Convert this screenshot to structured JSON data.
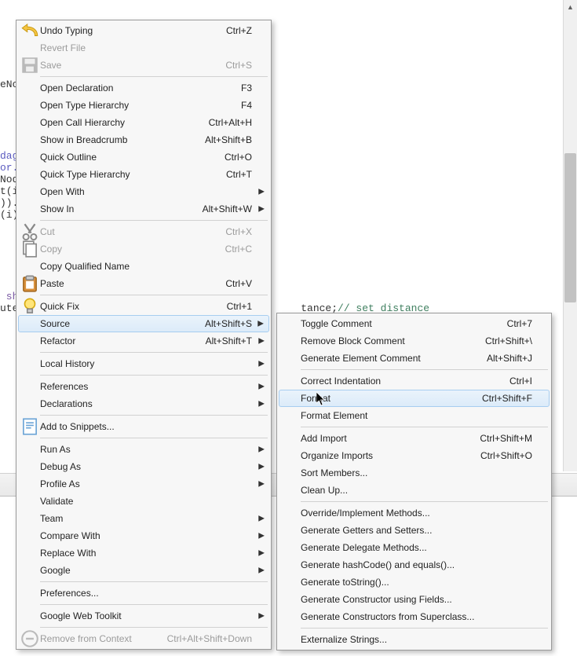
{
  "editor": {
    "visible_fragments": [
      "eNoc",
      "dage",
      "or.",
      "Nod",
      "t(i",
      ")).",
      "(i)",
      " sh",
      "ute"
    ],
    "right_code": {
      "prefix": "tance;",
      "comment": "// set distance"
    }
  },
  "main_menu": [
    {
      "icon": "undo",
      "label": "Undo Typing",
      "shortcut": "Ctrl+Z"
    },
    {
      "disabled": true,
      "label": "Revert File",
      "shortcut": ""
    },
    {
      "icon": "save",
      "disabled": true,
      "label": "Save",
      "shortcut": "Ctrl+S"
    },
    {
      "sep": true
    },
    {
      "label": "Open Declaration",
      "shortcut": "F3"
    },
    {
      "label": "Open Type Hierarchy",
      "shortcut": "F4"
    },
    {
      "label": "Open Call Hierarchy",
      "shortcut": "Ctrl+Alt+H"
    },
    {
      "label": "Show in Breadcrumb",
      "shortcut": "Alt+Shift+B"
    },
    {
      "label": "Quick Outline",
      "shortcut": "Ctrl+O"
    },
    {
      "label": "Quick Type Hierarchy",
      "shortcut": "Ctrl+T"
    },
    {
      "label": "Open With",
      "submenu": true
    },
    {
      "label": "Show In",
      "shortcut": "Alt+Shift+W",
      "submenu": true
    },
    {
      "sep": true
    },
    {
      "icon": "cut",
      "disabled": true,
      "label": "Cut",
      "shortcut": "Ctrl+X"
    },
    {
      "icon": "copy",
      "disabled": true,
      "label": "Copy",
      "shortcut": "Ctrl+C"
    },
    {
      "label": "Copy Qualified Name",
      "shortcut": ""
    },
    {
      "icon": "paste",
      "label": "Paste",
      "shortcut": "Ctrl+V"
    },
    {
      "sep": true
    },
    {
      "icon": "lamp",
      "label": "Quick Fix",
      "shortcut": "Ctrl+1"
    },
    {
      "label": "Source",
      "shortcut": "Alt+Shift+S",
      "submenu": true,
      "highlight": true
    },
    {
      "label": "Refactor",
      "shortcut": "Alt+Shift+T",
      "submenu": true
    },
    {
      "sep": true
    },
    {
      "label": "Local History",
      "submenu": true
    },
    {
      "sep": true
    },
    {
      "label": "References",
      "submenu": true
    },
    {
      "label": "Declarations",
      "submenu": true
    },
    {
      "sep": true
    },
    {
      "icon": "snippet",
      "label": "Add to Snippets..."
    },
    {
      "sep": true
    },
    {
      "label": "Run As",
      "submenu": true
    },
    {
      "label": "Debug As",
      "submenu": true
    },
    {
      "label": "Profile As",
      "submenu": true
    },
    {
      "label": "Validate"
    },
    {
      "label": "Team",
      "submenu": true
    },
    {
      "label": "Compare With",
      "submenu": true
    },
    {
      "label": "Replace With",
      "submenu": true
    },
    {
      "label": "Google",
      "submenu": true
    },
    {
      "sep": true
    },
    {
      "label": "Preferences..."
    },
    {
      "sep": true
    },
    {
      "label": "Google Web Toolkit",
      "submenu": true
    },
    {
      "sep": true
    },
    {
      "icon": "remove",
      "disabled": true,
      "label": "Remove from Context",
      "shortcut": "Ctrl+Alt+Shift+Down"
    }
  ],
  "sub_menu": [
    {
      "label": "Toggle Comment",
      "shortcut": "Ctrl+7"
    },
    {
      "label": "Remove Block Comment",
      "shortcut": "Ctrl+Shift+\\"
    },
    {
      "label": "Generate Element Comment",
      "shortcut": "Alt+Shift+J"
    },
    {
      "sep": true
    },
    {
      "label": "Correct Indentation",
      "shortcut": "Ctrl+I"
    },
    {
      "label": "Format",
      "shortcut": "Ctrl+Shift+F",
      "highlight": true
    },
    {
      "label": "Format Element"
    },
    {
      "sep": true
    },
    {
      "label": "Add Import",
      "shortcut": "Ctrl+Shift+M"
    },
    {
      "label": "Organize Imports",
      "shortcut": "Ctrl+Shift+O"
    },
    {
      "label": "Sort Members..."
    },
    {
      "label": "Clean Up..."
    },
    {
      "sep": true
    },
    {
      "label": "Override/Implement Methods..."
    },
    {
      "label": "Generate Getters and Setters..."
    },
    {
      "label": "Generate Delegate Methods..."
    },
    {
      "label": "Generate hashCode() and equals()..."
    },
    {
      "label": "Generate toString()..."
    },
    {
      "label": "Generate Constructor using Fields..."
    },
    {
      "label": "Generate Constructors from Superclass..."
    },
    {
      "sep": true
    },
    {
      "label": "Externalize Strings..."
    }
  ]
}
